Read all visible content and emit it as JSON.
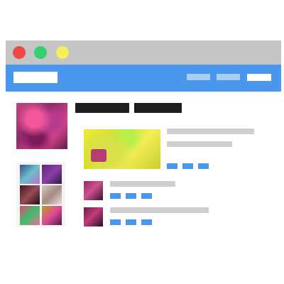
{
  "window": {
    "controls": [
      {
        "name": "close",
        "color": "#f04848"
      },
      {
        "name": "maximize",
        "color": "#34d06e"
      },
      {
        "name": "minimize",
        "color": "#f7ee5a"
      }
    ]
  },
  "colors": {
    "titlebar": "#c5c5c5",
    "navbar": "#4a98ee",
    "nav_link_inactive": "#a9cdf3",
    "nav_link_active": "#ffffff",
    "text_placeholder": "#cfcfcf",
    "name_placeholder": "#1e1e1e",
    "action_placeholder": "#4a98ee"
  },
  "navbar": {
    "logo": "logo-placeholder",
    "links": [
      "nav-link-placeholder",
      "nav-link-placeholder",
      "nav-link-placeholder-active"
    ]
  },
  "profile": {
    "photo": "profile-photo",
    "name_parts": [
      "first-name-placeholder",
      "last-name-placeholder"
    ]
  },
  "gallery": {
    "thumbnails": 6
  },
  "feed": {
    "featured_post": {
      "image": "post-image",
      "text_lines": 2,
      "actions": 3
    },
    "posts": [
      {
        "avatar": "post-avatar",
        "text_lines": 1,
        "actions": 3
      },
      {
        "avatar": "post-avatar",
        "text_lines": 1,
        "actions": 3
      }
    ]
  }
}
